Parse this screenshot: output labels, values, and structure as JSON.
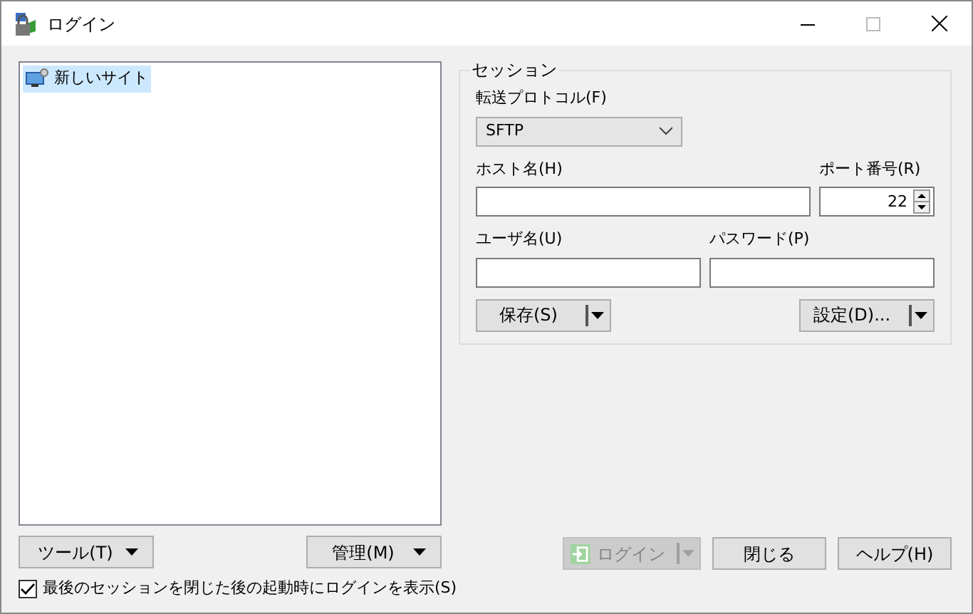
{
  "window": {
    "title": "ログイン"
  },
  "sites": [
    {
      "label": "新しいサイト",
      "selected": true
    }
  ],
  "session": {
    "title": "セッション",
    "protocol": {
      "label": "転送プロトコル(F)",
      "value": "SFTP"
    },
    "host": {
      "label": "ホスト名(H)"
    },
    "port": {
      "label": "ポート番号(R)",
      "value": "22"
    },
    "user": {
      "label": "ユーザ名(U)"
    },
    "password": {
      "label": "パスワード(P)"
    },
    "buttons": [
      {
        "label": "保存(S)",
        "kind": "split"
      },
      {
        "label": "設定(D)...",
        "kind": "split"
      }
    ]
  },
  "left_buttons": [
    {
      "label": "ツール(T)"
    },
    {
      "label": "管理(M)"
    }
  ],
  "dialog_buttons": [
    {
      "label": "ログイン",
      "kind": "login",
      "disabled": true
    },
    {
      "label": "閉じる",
      "kind": "plain",
      "disabled": false
    },
    {
      "label": "ヘルプ(H)",
      "kind": "plain",
      "disabled": false
    }
  ],
  "show_login_option": {
    "label": "最後のセッションを閉じた後の起動時にログインを表示(S)",
    "checked": true
  }
}
